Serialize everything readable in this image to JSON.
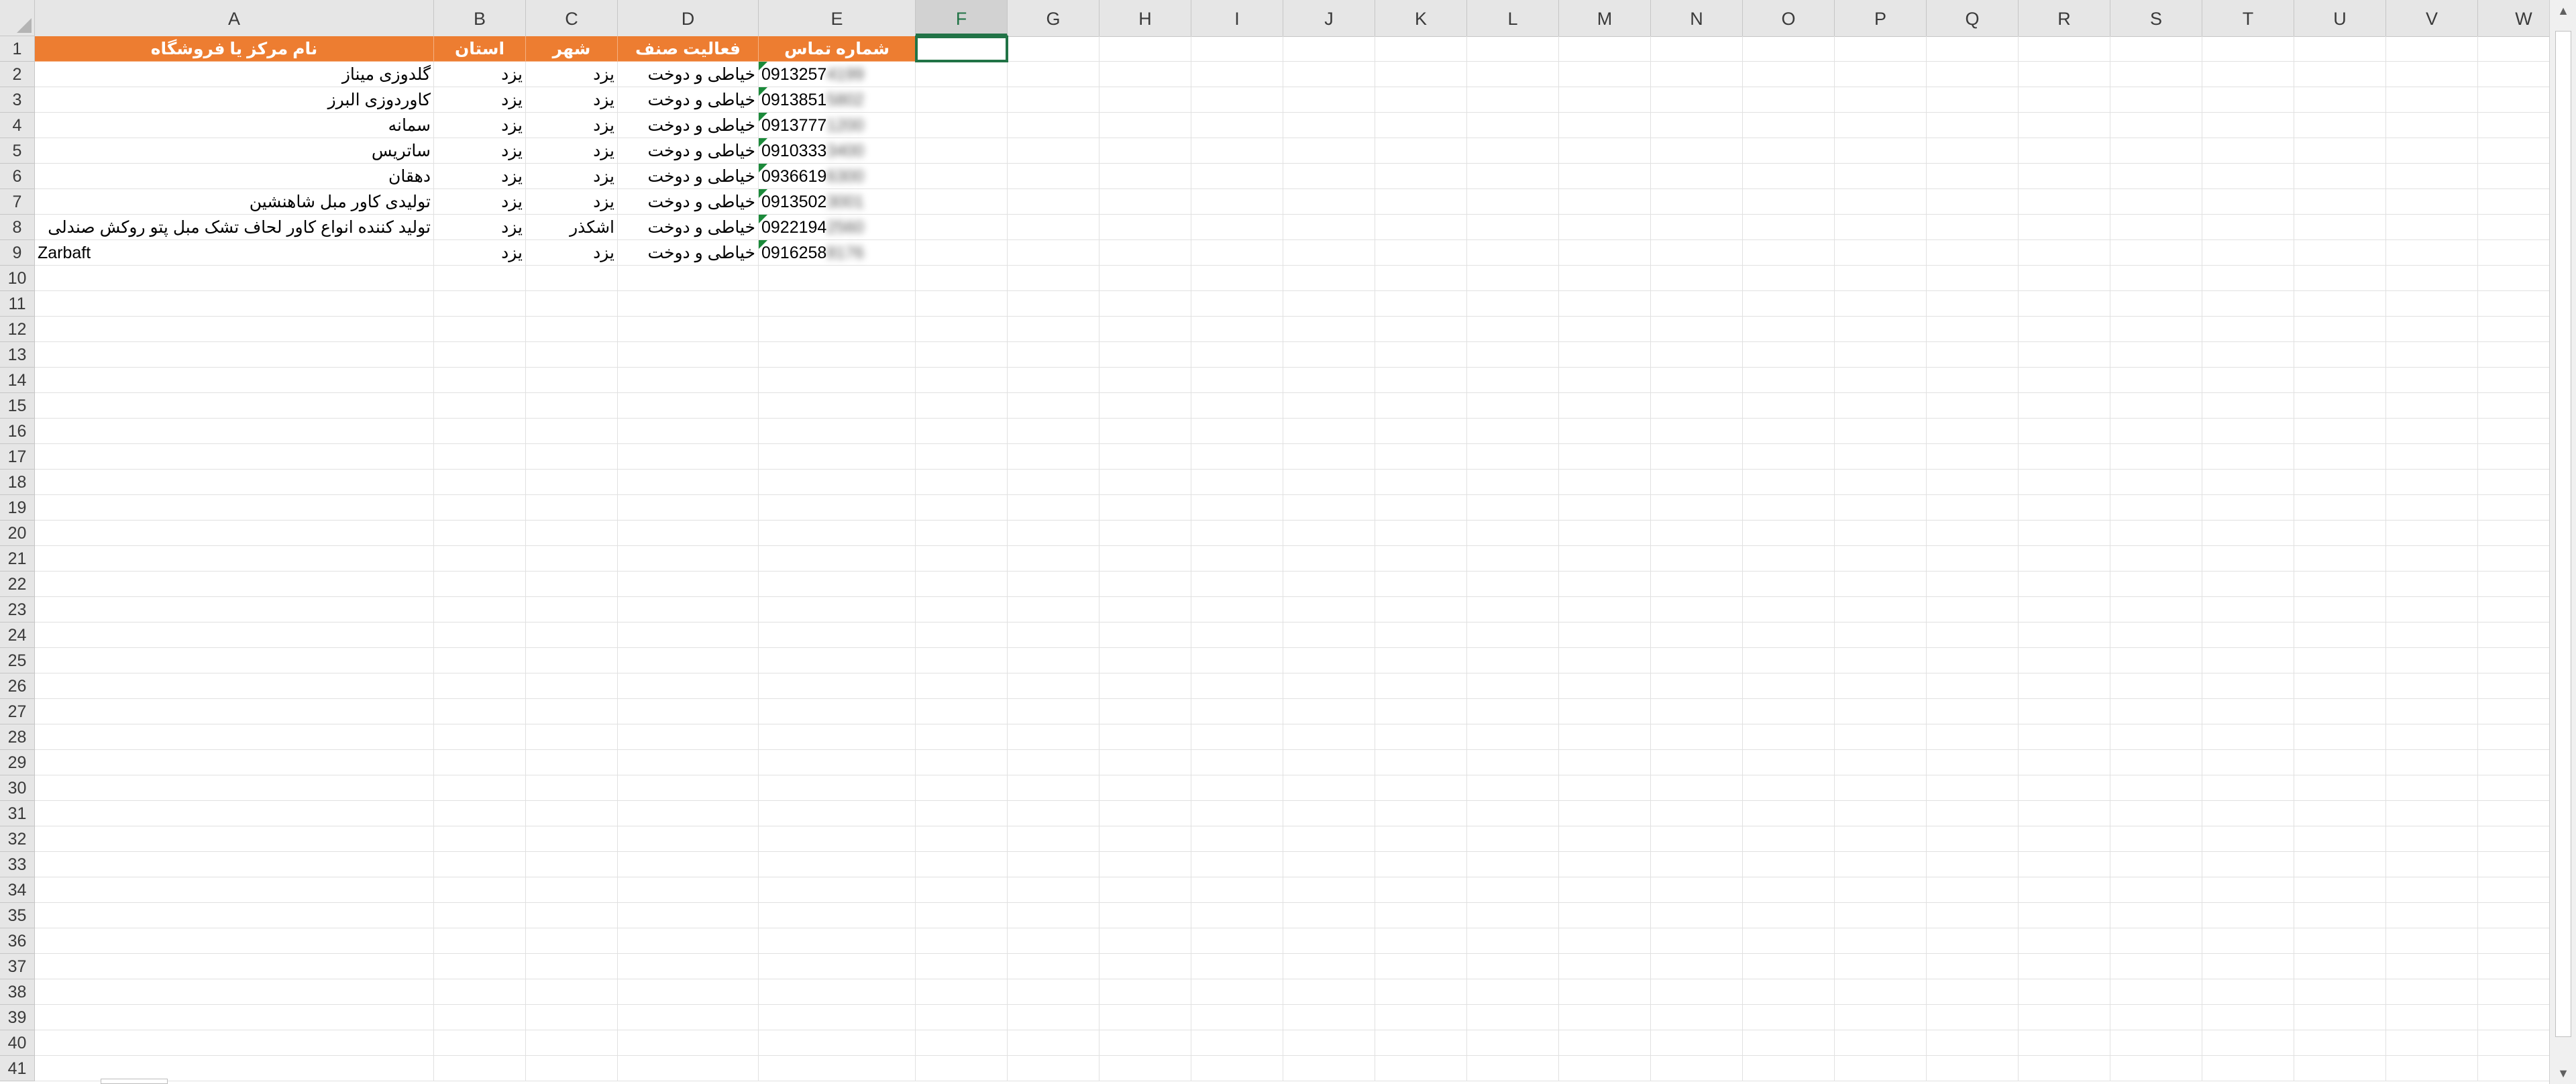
{
  "columns": [
    "A",
    "B",
    "C",
    "D",
    "E",
    "F",
    "G",
    "H",
    "I",
    "J",
    "K",
    "L",
    "M",
    "N",
    "O",
    "P",
    "Q",
    "R",
    "S",
    "T",
    "U",
    "V",
    "W"
  ],
  "selected_column": "F",
  "header_row": {
    "name": "نام مرکز یا فروشگاه",
    "province": "استان",
    "city": "شهر",
    "activity": "فعالیت صنف",
    "phone": "شماره تماس"
  },
  "rows": [
    {
      "name": "گلدوزی میناز",
      "province": "یزد",
      "city": "یزد",
      "activity": "خیاطی و دوخت",
      "phone": "0913257",
      "phone_hidden": "4199"
    },
    {
      "name": "کاوردوزی البرز",
      "province": "یزد",
      "city": "یزد",
      "activity": "خیاطی و دوخت",
      "phone": "0913851",
      "phone_hidden": "5802"
    },
    {
      "name": "سمانه",
      "province": "یزد",
      "city": "یزد",
      "activity": "خیاطی و دوخت",
      "phone": "0913777",
      "phone_hidden": "1200"
    },
    {
      "name": "ساتریس",
      "province": "یزد",
      "city": "یزد",
      "activity": "خیاطی و دوخت",
      "phone": "0910333",
      "phone_hidden": "3400"
    },
    {
      "name": "دهقان",
      "province": "یزد",
      "city": "یزد",
      "activity": "خیاطی و دوخت",
      "phone": "0936619",
      "phone_hidden": "6300"
    },
    {
      "name": "تولیدی کاور مبل شاهنشین",
      "province": "یزد",
      "city": "یزد",
      "activity": "خیاطی و دوخت",
      "phone": "0913502",
      "phone_hidden": "3001"
    },
    {
      "name": "تولید کننده انواع کاور لحاف تشک مبل پتو روکش صندلی",
      "province": "یزد",
      "city": "اشکذر",
      "activity": "خیاطی و دوخت",
      "phone": "0922194",
      "phone_hidden": "2560"
    },
    {
      "name": "Zarbaft",
      "province": "یزد",
      "city": "یزد",
      "activity": "خیاطی و دوخت",
      "phone": "0916258",
      "phone_hidden": "8176"
    }
  ],
  "total_rows": 41,
  "colors": {
    "header_fill": "#ed7d31",
    "header_text": "#ffffff",
    "selection": "#217346",
    "error_flag": "#1b8a3a"
  }
}
